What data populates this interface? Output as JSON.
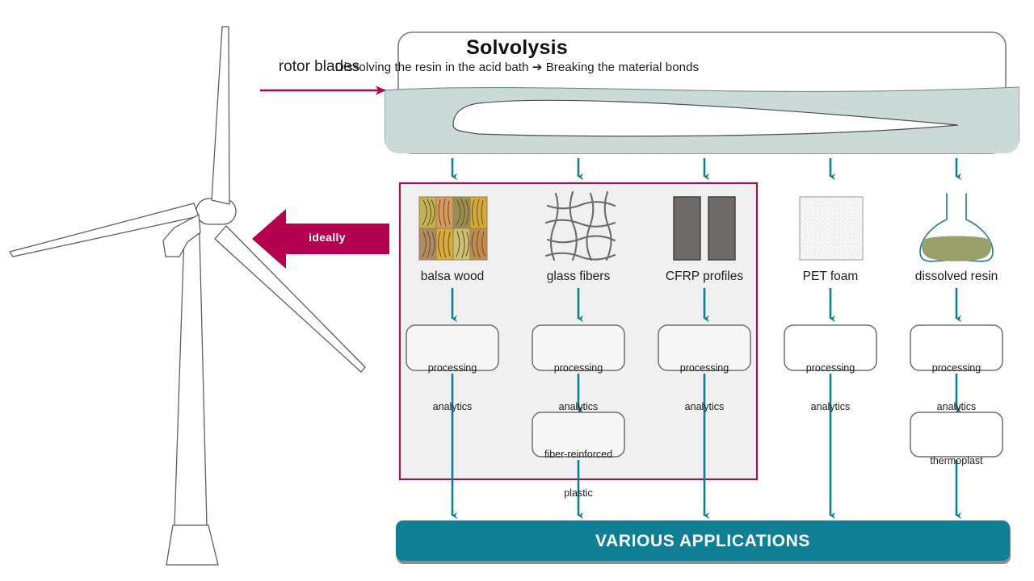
{
  "diagram": {
    "title_block": {
      "title": "Solvolysis",
      "subtitle": "Dissolving the resin in the acid bath ➔ Breaking the material bonds"
    },
    "input_arrow": {
      "label": "rotor blades"
    },
    "return_arrow": {
      "label": "ideally"
    },
    "materials": [
      {
        "id": "balsa-wood",
        "label": "balsa wood",
        "icon": "wood-grain-swatch-icon",
        "in_highlight": true
      },
      {
        "id": "glass-fibers",
        "label": "glass fibers",
        "icon": "woven-mesh-icon",
        "in_highlight": true
      },
      {
        "id": "cfrp-profiles",
        "label": "CFRP profiles",
        "icon": "two-gray-bars-icon",
        "in_highlight": true
      },
      {
        "id": "pet-foam",
        "label": "PET foam",
        "icon": "speckled-foam-icon",
        "in_highlight": false
      },
      {
        "id": "dissolved-resin",
        "label": "dissolved resin",
        "icon": "flask-icon",
        "in_highlight": false
      }
    ],
    "processing_boxes": [
      {
        "line1": "processing",
        "line2": "analytics"
      },
      {
        "line1": "processing",
        "line2": "analytics"
      },
      {
        "line1": "processing",
        "line2": "analytics"
      },
      {
        "line1": "processing",
        "line2": "analytics"
      },
      {
        "line1": "processing",
        "line2": "analytics"
      }
    ],
    "secondary_boxes": [
      {
        "column": "glass-fibers",
        "line1": "fiber-reinforced",
        "line2": "plastic"
      },
      {
        "column": "dissolved-resin",
        "line1": "thermoplast",
        "line2": ""
      }
    ],
    "bottom_bar": {
      "label": "VARIOUS APPLICATIONS"
    },
    "colors": {
      "accent_teal": "#0e7f94",
      "accent_crimson": "#b4004e",
      "highlight_border": "#8e1a5a",
      "highlight_fill": "#f0f0f0",
      "bath_fill": "#c9ddd8",
      "outline_gray": "#595959",
      "resin_olive": "#9aa06a",
      "cfrp_gray": "#6e6a6a"
    }
  }
}
